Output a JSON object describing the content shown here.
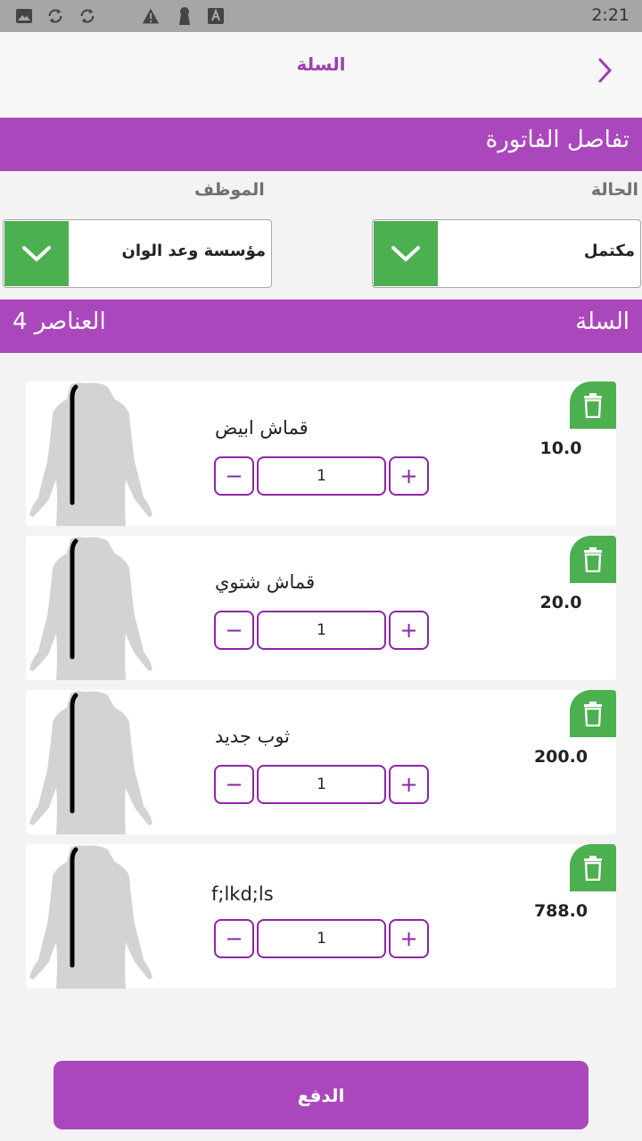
{
  "status_bar": {
    "time": "2:21",
    "icons": [
      "image-icon",
      "sync-icon",
      "sync-icon",
      "warning-icon",
      "keyhole-icon",
      "text-a-icon"
    ]
  },
  "header": {
    "title": "السلة",
    "back_icon": "chevron-right-icon"
  },
  "invoice": {
    "section_title": "تفاصل الفاتورة",
    "status_label": "الحالة",
    "status_value": "مكتمل",
    "employee_label": "الموظف",
    "employee_value": "مؤسسة وعد الوان"
  },
  "cart": {
    "section_title": "السلة",
    "count_text": "العناصر 4",
    "items": [
      {
        "name": "قماش ابيض",
        "price": "10.0",
        "quantity": "1"
      },
      {
        "name": "قماش شتوي",
        "price": "20.0",
        "quantity": "1"
      },
      {
        "name": "ثوب جديد",
        "price": "200.0",
        "quantity": "1"
      },
      {
        "name": "f;lkd;ls",
        "price": "788.0",
        "quantity": "1"
      }
    ],
    "minus_label": "−",
    "plus_label": "+"
  },
  "pay_button": {
    "label": "الدفع"
  },
  "colors": {
    "accent": "#ab47bc",
    "title_purple": "#9d3fb3",
    "stepper_border": "#8e24aa",
    "green": "#4caf50",
    "status_bar": "#a6a6a6"
  }
}
